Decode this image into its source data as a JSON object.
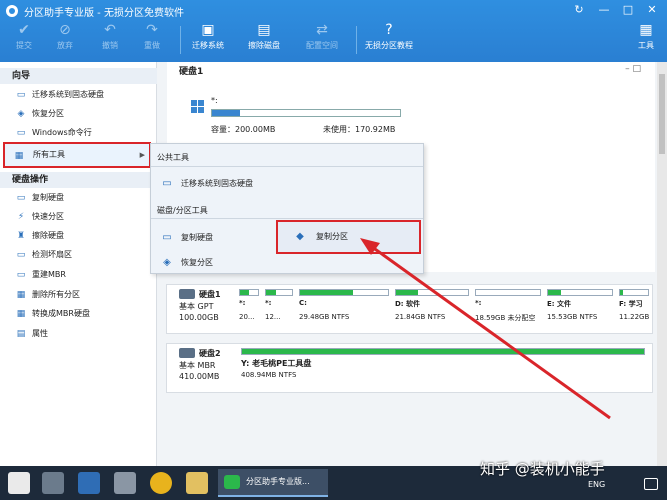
{
  "window": {
    "title": "分区助手专业版 - 无损分区免费软件"
  },
  "toolbar": {
    "commit": "提交",
    "discard": "放弃",
    "undo": "撤销",
    "redo": "重做",
    "migrate": "迁移系统",
    "wipe": "擦除磁盘",
    "alloc": "配置空间",
    "tutorial": "无损分区教程",
    "tools": "工具"
  },
  "sidebar": {
    "guide_head": "向导",
    "guide_items": [
      "迁移系统到固态硬盘",
      "恢复分区",
      "Windows命令行",
      "所有工具"
    ],
    "disk_head": "硬盘操作",
    "disk_items": [
      "复制硬盘",
      "快速分区",
      "擦除硬盘",
      "检测坏扇区",
      "重建MBR",
      "删除所有分区",
      "转换成MBR硬盘",
      "属性"
    ]
  },
  "disk1_panel": {
    "title": "硬盘1",
    "partition": {
      "drive": "*:",
      "capacity": "容量：200.00MB",
      "unused": "未使用：170.92MB",
      "fill_fraction": 0.15
    }
  },
  "flyout": {
    "public_head": "公共工具",
    "public_items": [
      "迁移系统到固态硬盘"
    ],
    "disk_head": "磁盘/分区工具",
    "copy_disk": "复制硬盘",
    "copy_partition": "复制分区",
    "restore_partition": "恢复分区"
  },
  "disks": [
    {
      "name": "硬盘1",
      "type": "基本 GPT",
      "size": "100.00GB",
      "partitions": [
        {
          "label": "*:",
          "size": "20...",
          "fill": 0.5
        },
        {
          "label": "*:",
          "size": "12...",
          "fill": 0.4
        },
        {
          "label": "C:",
          "size": "29.48GB NTFS",
          "fill": 0.6
        },
        {
          "label": "D: 软件",
          "size": "21.84GB NTFS",
          "fill": 0.3
        },
        {
          "label": "*:",
          "size": "18.59GB 未分配空",
          "fill": 0.0
        },
        {
          "label": "E: 文件",
          "size": "15.53GB NTFS",
          "fill": 0.2
        },
        {
          "label": "F: 学习",
          "size": "11.22GB",
          "fill": 0.1
        }
      ]
    },
    {
      "name": "硬盘2",
      "type": "基本 MBR",
      "size": "410.00MB",
      "partition": {
        "label": "Y: 老毛桃PE工具盘",
        "size": "408.94MB NTFS"
      }
    }
  ],
  "taskbar": {
    "active_app": "分区助手专业版...",
    "lang": "ENG"
  },
  "watermark": "知乎 @装机小能手"
}
